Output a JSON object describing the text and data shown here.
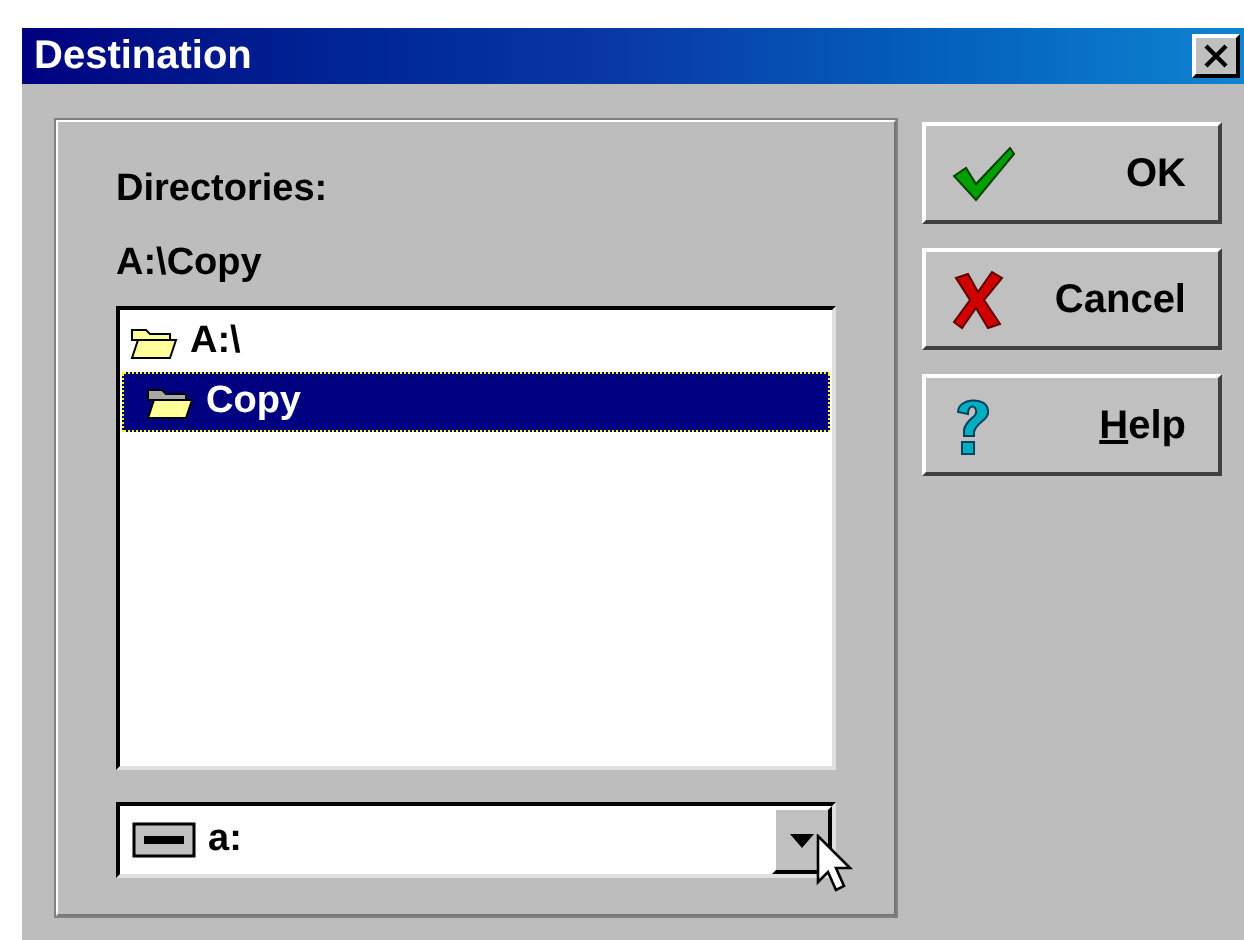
{
  "window": {
    "title": "Destination"
  },
  "directories": {
    "label": "Directories:",
    "current_path": "A:\\Copy",
    "tree": [
      {
        "label": "A:\\",
        "selected": false,
        "children": [
          {
            "label": "Copy",
            "selected": true
          }
        ]
      }
    ]
  },
  "drive": {
    "value": "a:"
  },
  "buttons": [
    {
      "kind": "ok",
      "label": "OK",
      "underline_first": false
    },
    {
      "kind": "cancel",
      "label": "Cancel",
      "underline_first": false
    },
    {
      "kind": "help",
      "label": "Help",
      "underline_first": true
    }
  ]
}
